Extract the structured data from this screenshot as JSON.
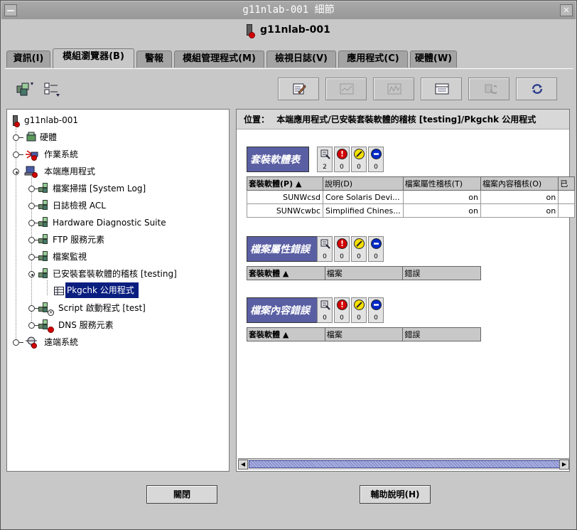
{
  "window": {
    "title": "g11nlab-001 細節",
    "close_glyph": "✕"
  },
  "host": {
    "name": "g11nlab-001"
  },
  "tabs": [
    {
      "label": "資訊(I)"
    },
    {
      "label": "模組瀏覽器(B)"
    },
    {
      "label": "警報"
    },
    {
      "label": "模組管理程式(M)"
    },
    {
      "label": "檢視日誌(V)"
    },
    {
      "label": "應用程式(C)"
    },
    {
      "label": "硬體(W)"
    }
  ],
  "active_tab": "模組瀏覽器(B)",
  "toolbar": {
    "left_icons": [
      "modules-icon",
      "view-options-icon"
    ],
    "right_icons": [
      "edit-icon",
      "graph-icon",
      "chart-icon",
      "table-view-icon",
      "refresh-icon",
      "auto-refresh-icon"
    ]
  },
  "tree": {
    "root": "g11nlab-001",
    "items": [
      {
        "label": "硬體"
      },
      {
        "label": "作業系統"
      },
      {
        "label": "本端應用程式"
      },
      {
        "label": "檔案掃描 [System Log]"
      },
      {
        "label": "日誌檢視 ACL"
      },
      {
        "label": "Hardware Diagnostic Suite"
      },
      {
        "label": "FTP 服務元素"
      },
      {
        "label": "檔案監視"
      },
      {
        "label": "已安裝套裝軟體的稽核 [testing]"
      },
      {
        "label": "Pkgchk 公用程式"
      },
      {
        "label": "Script 啟動程式 [test]"
      },
      {
        "label": "DNS 服務元素"
      },
      {
        "label": "遠端系統"
      }
    ]
  },
  "location": {
    "label": "位置：",
    "path": "本端應用程式/已安裝套裝軟體的稽核 [testing]/Pkgchk 公用程式"
  },
  "sections": [
    {
      "title": "套裝軟體表",
      "counts": [
        "2",
        "0",
        "0",
        "0"
      ],
      "headers": [
        "套裝軟體(P) ▲",
        "說明(D)",
        "檔案屬性稽核(T)",
        "檔案內容稽核(O)",
        "已"
      ],
      "rows": [
        [
          "SUNWcsd",
          "Core Solaris Devi...",
          "on",
          "on",
          ""
        ],
        [
          "SUNWcwbc",
          "Simplified Chines...",
          "on",
          "on",
          ""
        ]
      ]
    },
    {
      "title": "檔案屬性錯誤",
      "counts": [
        "0",
        "0",
        "0",
        "0"
      ],
      "headers": [
        "套裝軟體 ▲",
        "檔案",
        "錯誤"
      ]
    },
    {
      "title": "檔案內容錯誤",
      "counts": [
        "0",
        "0",
        "0",
        "0"
      ],
      "headers": [
        "套裝軟體 ▲",
        "檔案",
        "錯誤"
      ]
    }
  ],
  "buttons": {
    "close": "關閉",
    "help": "輔助說明(H)"
  },
  "colors": {
    "selection": "#0a1e80",
    "section_header": "#5a5fa3",
    "alarm_red": "#d40000",
    "alarm_yellow": "#f5e000",
    "alarm_blue": "#0028c8"
  }
}
